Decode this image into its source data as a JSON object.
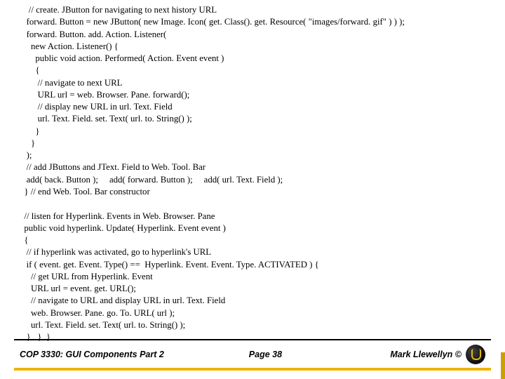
{
  "code": {
    "l01": "    // create. JButton for navigating to next history URL",
    "l02": "   forward. Button = new JButton( new Image. Icon( get. Class(). get. Resource( \"images/forward. gif\" ) ) );",
    "l03": "   forward. Button. add. Action. Listener(",
    "l04": "     new Action. Listener() {",
    "l05": "       public void action. Performed( Action. Event event )",
    "l06": "       {",
    "l07": "        // navigate to next URL",
    "l08": "        URL url = web. Browser. Pane. forward();",
    "l09": "        // display new URL in url. Text. Field",
    "l10": "        url. Text. Field. set. Text( url. to. String() );",
    "l11": "       }",
    "l12": "     }",
    "l13": "   );",
    "l14": "   // add JButtons and JText. Field to Web. Tool. Bar",
    "l15": "   add( back. Button );     add( forward. Button );     add( url. Text. Field );",
    "l16": "  } // end Web. Tool. Bar constructor",
    "l17": " ",
    "l18": "  // listen for Hyperlink. Events in Web. Browser. Pane",
    "l19": "  public void hyperlink. Update( Hyperlink. Event event )",
    "l20": "  {",
    "l21": "   // if hyperlink was activated, go to hyperlink's URL",
    "l22": "   if ( event. get. Event. Type() ==  Hyperlink. Event. Event. Type. ACTIVATED ) {",
    "l23": "     // get URL from Hyperlink. Event",
    "l24": "     URL url = event. get. URL();",
    "l25": "     // navigate to URL and display URL in url. Text. Field",
    "l26": "     web. Browser. Pane. go. To. URL( url );",
    "l27": "     url. Text. Field. set. Text( url. to. String() );",
    "l28": "   }   }  }"
  },
  "footer": {
    "course": "COP 3330: GUI Components Part 2",
    "page": "Page 38",
    "author": "Mark Llewellyn ©"
  }
}
